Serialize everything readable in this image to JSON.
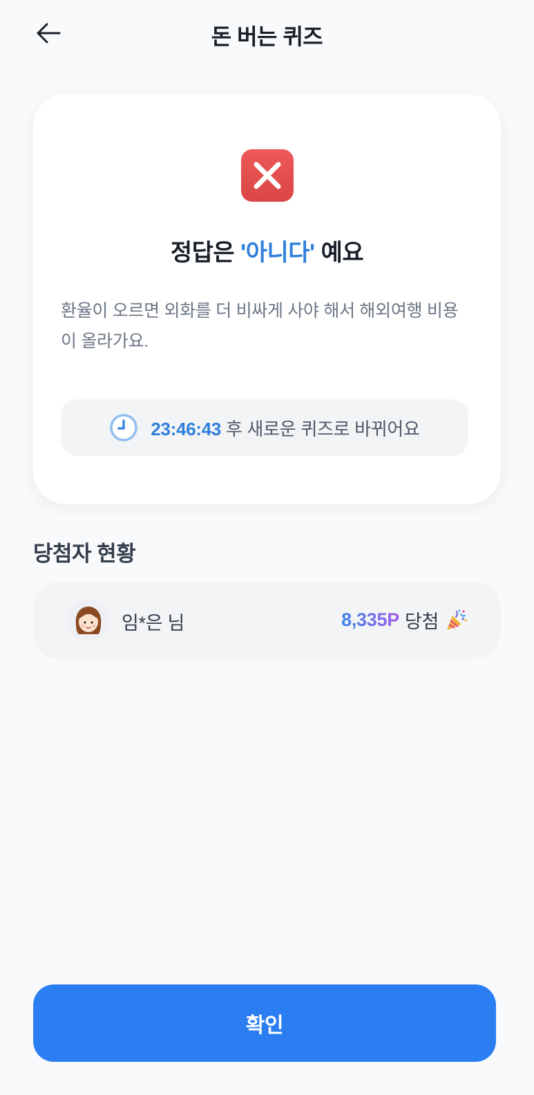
{
  "header": {
    "title": "돈 버는 퀴즈",
    "back_icon": "arrow-left-icon"
  },
  "result": {
    "icon": "x-mark-icon",
    "icon_color": "#e55050",
    "title_prefix": "정답은 ",
    "answer": "'아니다'",
    "title_suffix": " 예요",
    "explanation": "환율이 오르면 외화를 더 비싸게 사야 해서 해외여행 비용이 올라가요.",
    "timer": {
      "icon": "clock-icon",
      "time": "23:46:43",
      "suffix": " 후 새로운 퀴즈로 바뀌어요"
    }
  },
  "winners": {
    "title": "당첨자 현황",
    "items": [
      {
        "avatar": "girl-avatar-icon",
        "name": "임*은 님",
        "points": "8,335P",
        "label": "당첨",
        "emoji_icon": "party-popper-icon"
      }
    ]
  },
  "footer": {
    "confirm_label": "확인"
  },
  "colors": {
    "accent": "#2f7fdc",
    "button": "#2a7ef2",
    "error": "#e55050"
  }
}
